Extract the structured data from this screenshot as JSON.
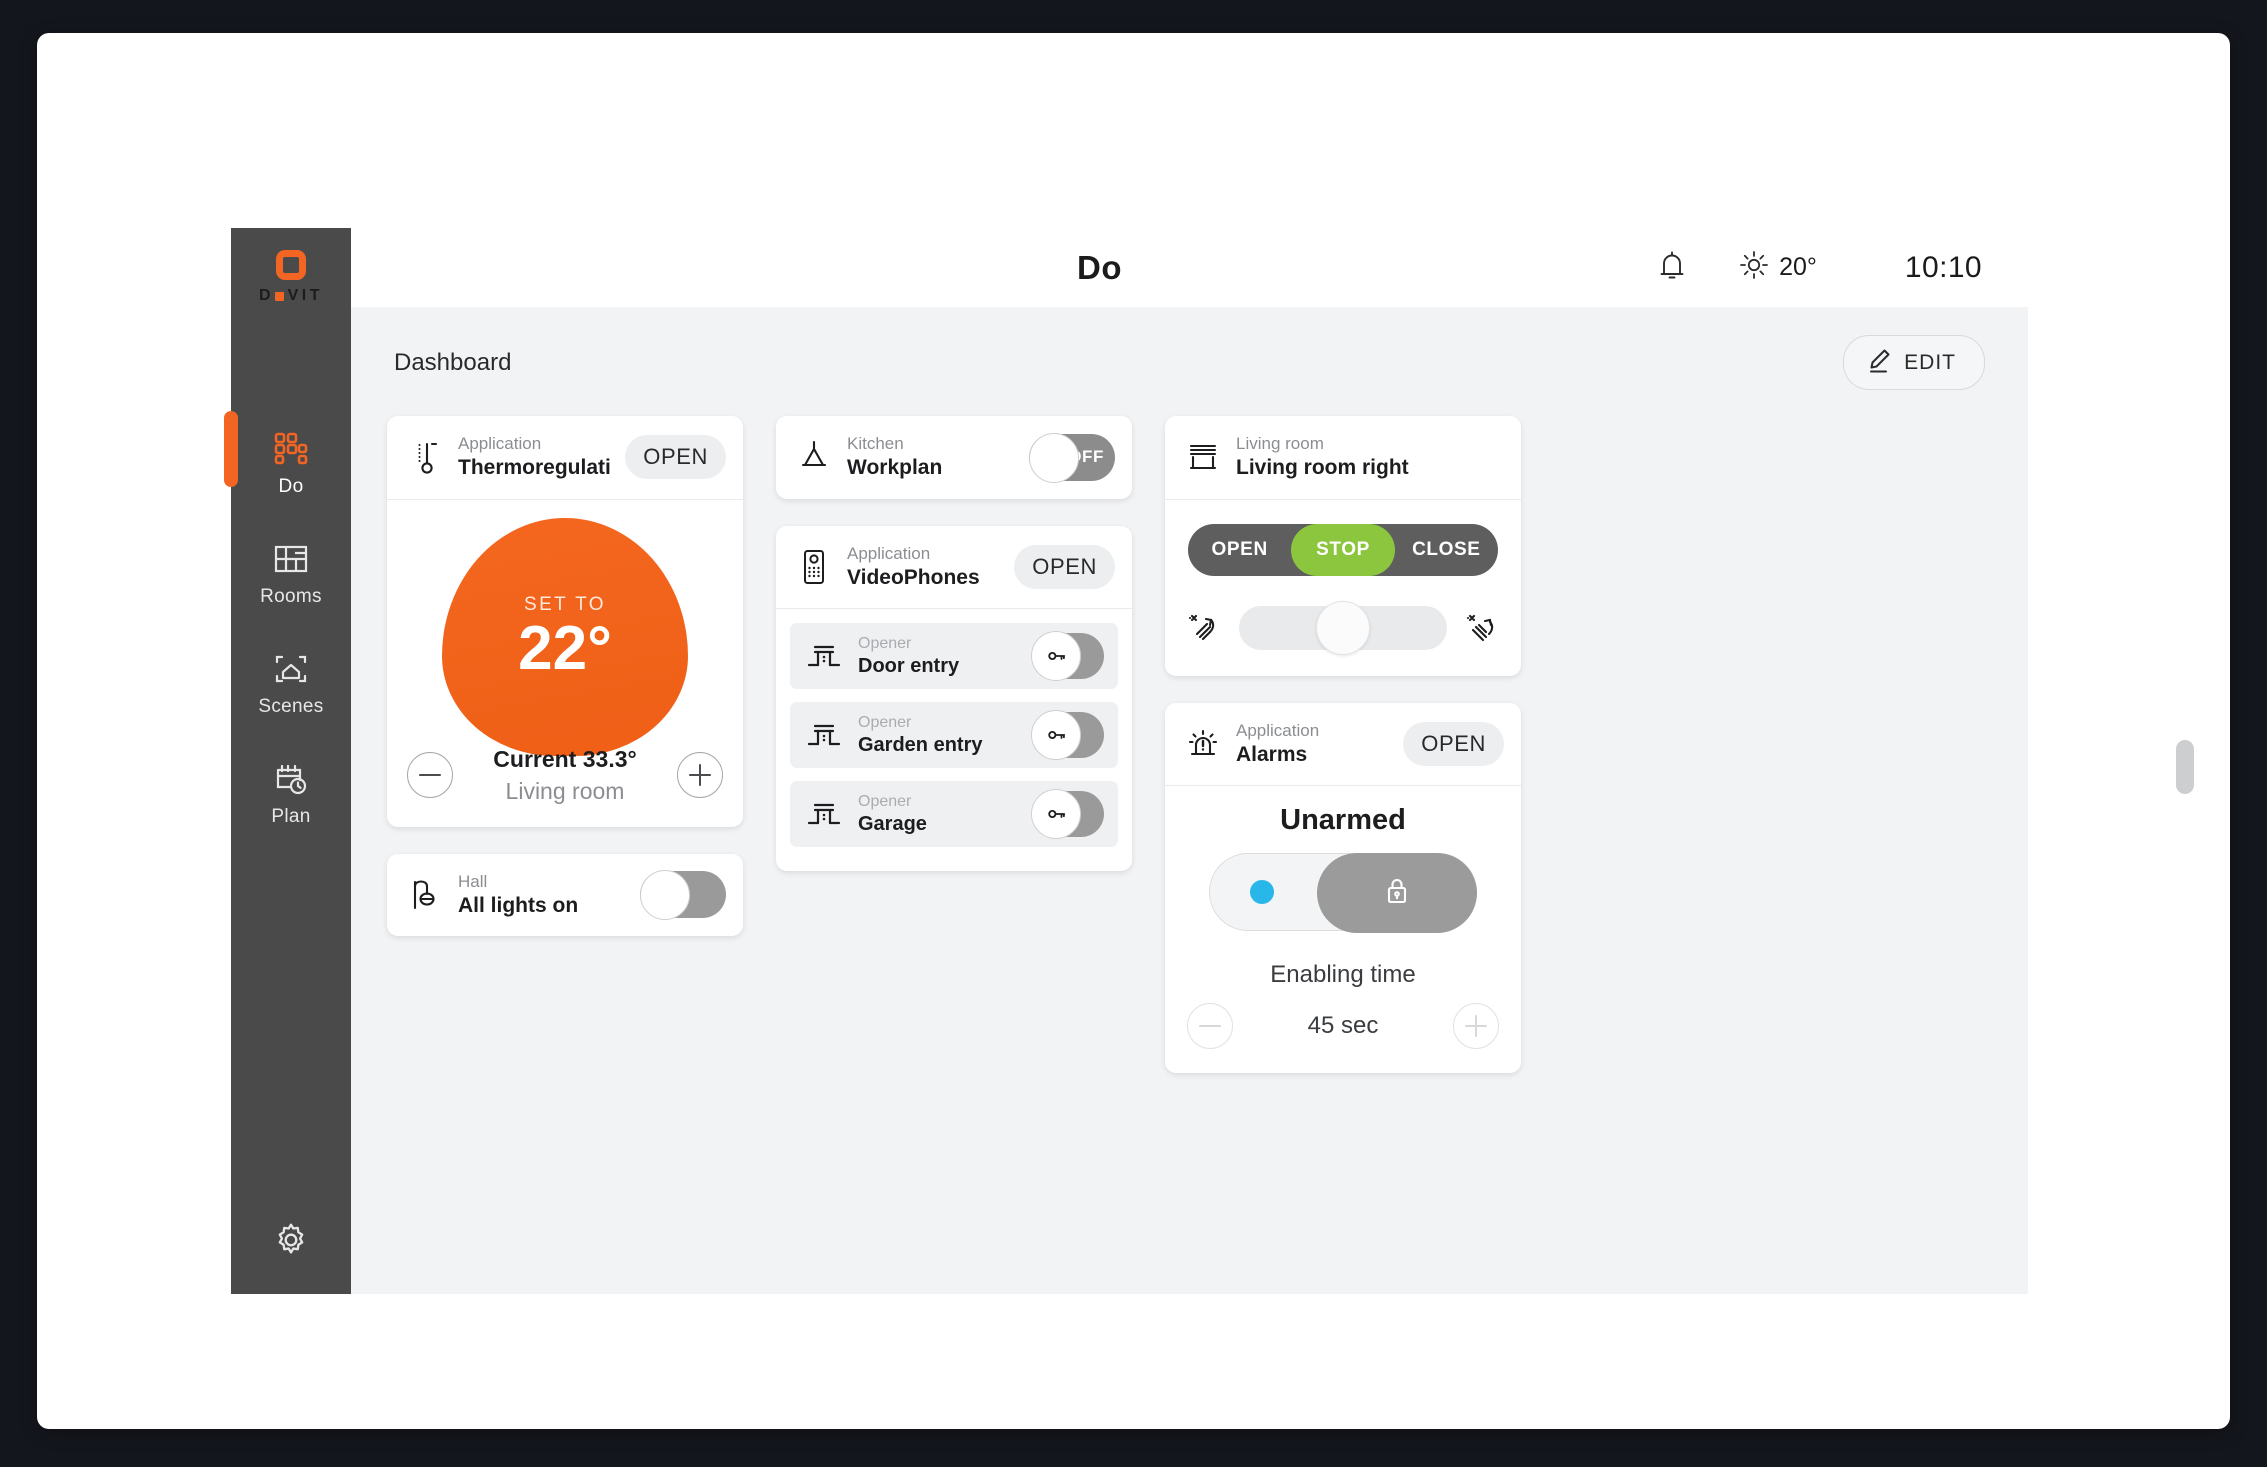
{
  "brand": {
    "name": "DOVIT",
    "accent": "#f26522"
  },
  "sidebar": {
    "items": [
      {
        "label": "Do",
        "icon": "grid-icon",
        "active": true
      },
      {
        "label": "Rooms",
        "icon": "floorplan-icon",
        "active": false
      },
      {
        "label": "Scenes",
        "icon": "house-frame-icon",
        "active": false
      },
      {
        "label": "Plan",
        "icon": "calendar-clock-icon",
        "active": false
      }
    ],
    "settings_icon": "gear-icon"
  },
  "topbar": {
    "title": "Do",
    "bell_icon": "bell-icon",
    "weather_icon": "sun-icon",
    "temperature": "20°",
    "clock": "10:10"
  },
  "content": {
    "heading": "Dashboard",
    "edit_label": "EDIT",
    "edit_icon": "pencil-icon"
  },
  "cards": {
    "thermoregulation": {
      "icon": "thermometer-icon",
      "subtitle": "Application",
      "title": "Thermoregulati...",
      "action_label": "OPEN",
      "set_to_label": "SET TO",
      "set_value": "22°",
      "current_label": "Current 33.3°",
      "room": "Living room",
      "minus_icon": "minus-icon",
      "plus_icon": "plus-icon"
    },
    "hall_lights": {
      "icon": "wall-lamp-icon",
      "subtitle": "Hall",
      "title": "All lights on",
      "toggle_state": "off",
      "toggle_label": ""
    },
    "kitchen_workplan": {
      "icon": "pendant-lamp-icon",
      "subtitle": "Kitchen",
      "title": "Workplan",
      "toggle_state": "off",
      "toggle_label": "OFF"
    },
    "videophones": {
      "icon": "videophone-icon",
      "subtitle": "Application",
      "title": "VideoPhones",
      "action_label": "OPEN",
      "openers": [
        {
          "sub": "Opener",
          "name": "Door entry",
          "icon": "gate-icon",
          "button_icon": "key-icon"
        },
        {
          "sub": "Opener",
          "name": "Garden entry",
          "icon": "gate-icon",
          "button_icon": "key-icon"
        },
        {
          "sub": "Opener",
          "name": "Garage",
          "icon": "gate-icon",
          "button_icon": "key-icon"
        }
      ]
    },
    "living_room_blind": {
      "icon": "blind-icon",
      "subtitle": "Living room",
      "title": "Living room right",
      "segments": [
        {
          "label": "OPEN",
          "active": false
        },
        {
          "label": "STOP",
          "active": true
        },
        {
          "label": "CLOSE",
          "active": false
        }
      ],
      "active_color": "#8cc63e",
      "tilt_left_icon": "blind-tilt-left-icon",
      "tilt_right_icon": "blind-tilt-right-icon",
      "slider_position_percent": 50
    },
    "alarms": {
      "icon": "siren-icon",
      "subtitle": "Application",
      "title": "Alarms",
      "action_label": "OPEN",
      "state": "Unarmed",
      "indicator_color": "#29b6e8",
      "lock_icon": "lock-icon",
      "enabling_time_label": "Enabling time",
      "enabling_time_value": "45 sec",
      "minus_icon": "minus-icon",
      "plus_icon": "plus-icon"
    }
  }
}
